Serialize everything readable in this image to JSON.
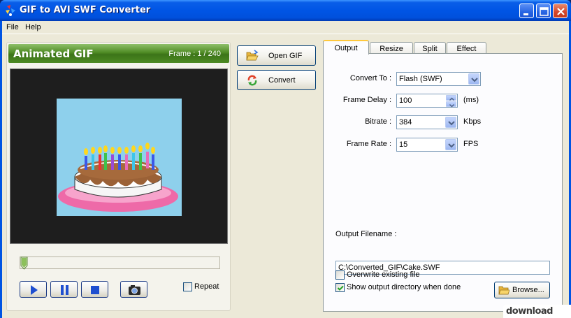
{
  "window": {
    "title": "GIF to AVI SWF Converter",
    "accent": "#0054e3"
  },
  "menu": {
    "file": "File",
    "help": "Help"
  },
  "preview_panel": {
    "title": "Animated GIF",
    "frame_counter": "Frame : 1 / 240",
    "header_color": "#4f8c25",
    "repeat_label": "Repeat",
    "repeat_checked": false,
    "seek_position": 0
  },
  "actions": {
    "open_gif": "Open GIF",
    "convert": "Convert"
  },
  "tabs": [
    {
      "label": "Output",
      "active": true
    },
    {
      "label": "Resize",
      "active": false
    },
    {
      "label": "Split",
      "active": false
    },
    {
      "label": "Effect",
      "active": false
    }
  ],
  "output": {
    "convert_to_label": "Convert To :",
    "convert_to_value": "Flash (SWF)",
    "frame_delay_label": "Frame Delay :",
    "frame_delay_value": "100",
    "frame_delay_unit": "(ms)",
    "bitrate_label": "Bitrate :",
    "bitrate_value": "384",
    "bitrate_unit": "Kbps",
    "frame_rate_label": "Frame Rate :",
    "frame_rate_value": "15",
    "frame_rate_unit": "FPS",
    "filename_label": "Output Filename :",
    "filename_value": "C:\\Converted_GIF\\Cake.SWF",
    "browse_label": "Browse...",
    "overwrite_label": "Overwrite existing file",
    "overwrite_checked": false,
    "show_dir_label": "Show output directory when done",
    "show_dir_checked": true
  },
  "watermark": {
    "text": "download"
  }
}
